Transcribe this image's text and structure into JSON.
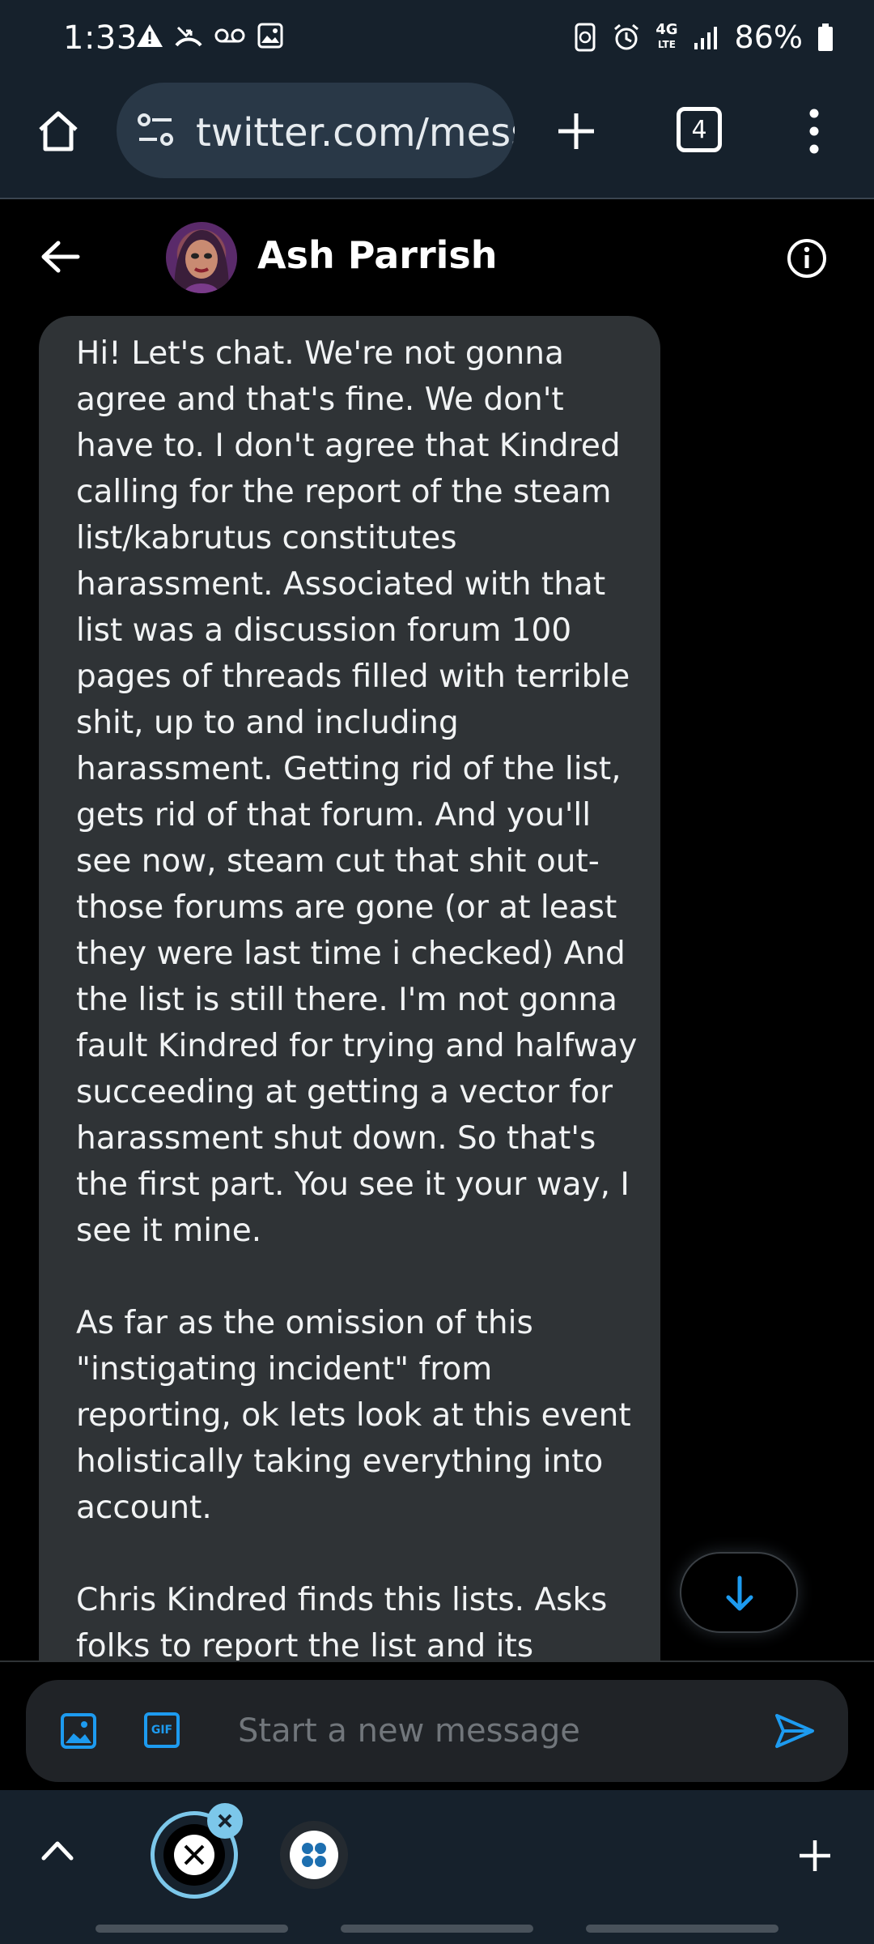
{
  "status_bar": {
    "time": "1:33",
    "battery": "86%",
    "network": "4G",
    "network_sub": "LTE"
  },
  "browser": {
    "url": "twitter.com/messages",
    "tab_count": "4"
  },
  "chat": {
    "contact_name": "Ash Parrish",
    "message": "Hi! Let's chat. We're not gonna agree and that's fine. We don't have to. I don't agree that Kindred calling for the report of the steam list/kabrutus constitutes harassment. Associated with that list was a discussion forum 100 pages of threads filled with terrible shit, up to and including harassment. Getting rid of the list, gets rid of that forum. And you'll see now, steam cut that shit out- those forums are gone (or at least they were last time i checked) And the list is still there. I'm not gonna fault Kindred for trying and halfway succeeding at getting a vector for harassment shut down. So that's the first part. You see it your way, I see it mine.\n\nAs far as the omission of this \"instigating incident\" from reporting, ok lets look at this event holistically taking everything into account.\n\nChris Kindred finds this lists. Asks folks to report the list and its"
  },
  "composer": {
    "placeholder": "Start a new message",
    "gif_label": "GIF"
  },
  "colors": {
    "accent": "#1d9bf0",
    "bubble": "#2f3336",
    "chrome": "#16212c"
  }
}
